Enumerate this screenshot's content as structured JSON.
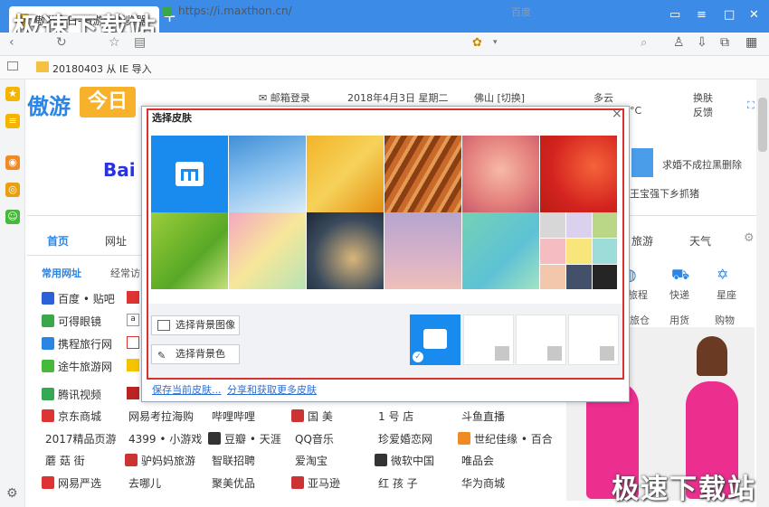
{
  "browser": {
    "tab_title": "傲游今日-傲游云浏览器",
    "new_tab": "+",
    "url": "https://i.maxthon.cn/",
    "search_placeholder": "百度",
    "bookmark_folder": "20180403 从 IE 导入"
  },
  "watermark": "极速下载站",
  "header": {
    "logo_text": "傲游",
    "logo_badge": "今日",
    "mail_login": "邮箱登录",
    "date": "2018年4月3日 星期二",
    "city": "佛山 [切换]",
    "weather": "多云",
    "temp": "°C",
    "skin_link": "换肤",
    "feedback_link": "反馈",
    "baidu": "Bai",
    "news1": "求婚不成拉黑删除",
    "news2": "王宝强下乡抓猪"
  },
  "nav_tabs": [
    "首页",
    "网址"
  ],
  "nav_tabs_right": [
    "旅游",
    "天气"
  ],
  "sub_tabs": [
    "常用网址",
    "经常访"
  ],
  "services": [
    "旅程",
    "快递",
    "星座"
  ],
  "services2": [
    "旅仓",
    "用货",
    "购物"
  ],
  "sites_col1": [
    "百度 • 贴吧",
    "可得眼镜",
    "携程旅行网",
    "途牛旅游网",
    "腾讯视频"
  ],
  "sites_rows": [
    [
      "京东商城",
      "网易考拉海购",
      "哔哩哔哩",
      "国 美",
      "1 号 店",
      "斗鱼直播"
    ],
    [
      "2017精品页游",
      "4399 • 小游戏",
      "豆瓣 • 天涯",
      "QQ音乐",
      "珍爱婚恋网",
      "世纪佳缘 • 百合"
    ],
    [
      "蘑 菇 街",
      "驴妈妈旅游",
      "智联招聘",
      "爱淘宝",
      "微软中国",
      "唯品会"
    ],
    [
      "网易严选",
      "去哪儿",
      "聚美优品",
      "亚马逊",
      "红 孩 子",
      "华为商城"
    ]
  ],
  "dialog": {
    "title": "选择皮肤",
    "close": "×",
    "choose_image": "选择背景图像",
    "choose_color": "选择背景色",
    "save_current": "保存当前皮肤...",
    "share_more": "分享和获取更多皮肤"
  },
  "colors": {
    "titlebar": "#3c8ce7",
    "accent": "#2b85e4",
    "highlight": "#d9322e"
  }
}
